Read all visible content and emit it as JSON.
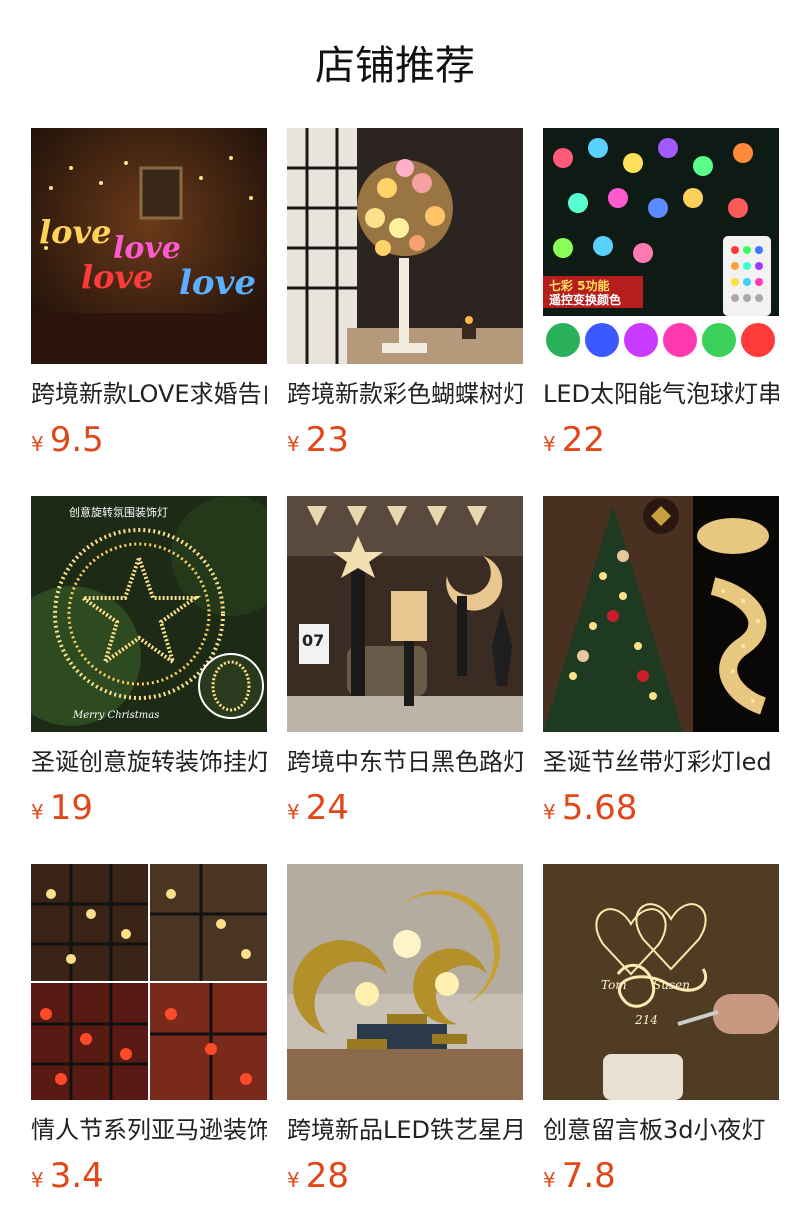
{
  "page": {
    "title": "店铺推荐"
  },
  "currency": "¥",
  "products": [
    {
      "name": "跨境新款LOVE求婚告白",
      "price": "9.5",
      "image": "neon-love-lights",
      "overlay": ""
    },
    {
      "name": "跨境新款彩色蝴蝶树灯",
      "price": "23",
      "image": "butterfly-tree-lamp",
      "overlay": ""
    },
    {
      "name": "LED太阳能气泡球灯串",
      "price": "22",
      "image": "bubble-ball-string-lights",
      "overlay": "七彩 5功能 遥控变换颜色"
    },
    {
      "name": "圣诞创意旋转装饰挂灯",
      "price": "19",
      "image": "rotating-star-ring-light",
      "overlay": "创意旋转氛围装饰灯"
    },
    {
      "name": "跨境中东节日黑色路灯",
      "price": "24",
      "image": "ramadan-moon-lamps",
      "overlay": ""
    },
    {
      "name": "圣诞节丝带灯彩灯led",
      "price": "5.68",
      "image": "christmas-tree-ribbon-lights",
      "overlay": ""
    },
    {
      "name": "情人节系列亚马逊装饰",
      "price": "3.4",
      "image": "valentine-string-lights-grid",
      "overlay": ""
    },
    {
      "name": "跨境新品LED铁艺星月灯",
      "price": "28",
      "image": "iron-moon-led-lamp",
      "overlay": ""
    },
    {
      "name": "创意留言板3d小夜灯",
      "price": "7.8",
      "image": "3d-message-night-light",
      "overlay": "Tom Susen 214"
    }
  ]
}
